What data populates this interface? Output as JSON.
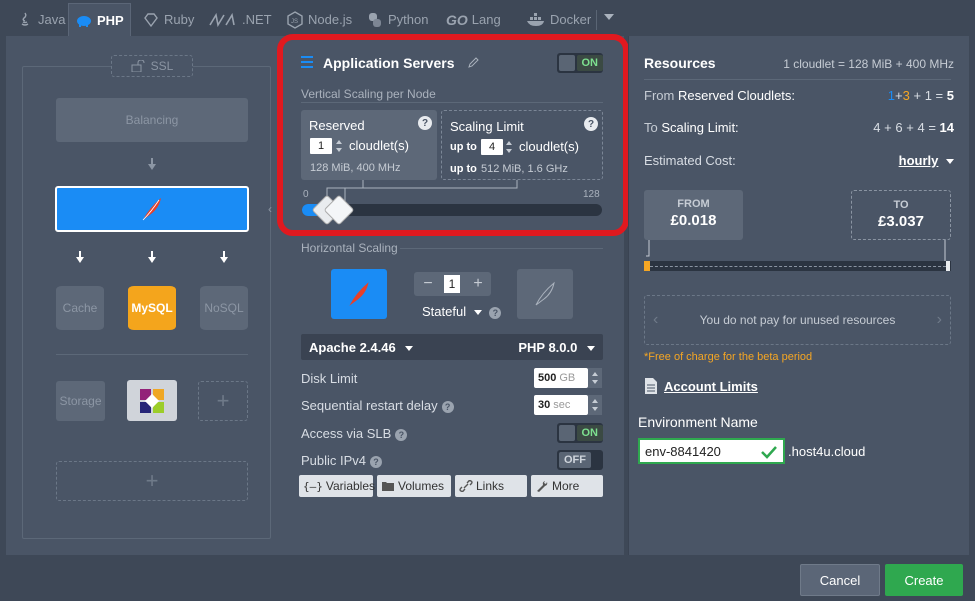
{
  "tabs": [
    {
      "label": "Java",
      "icon": "java-icon"
    },
    {
      "label": "PHP",
      "icon": "php-elephant-icon",
      "active": true
    },
    {
      "label": "Ruby",
      "icon": "ruby-icon"
    },
    {
      "label": ".NET",
      "icon": "dotnet-icon"
    },
    {
      "label": "Node.js",
      "icon": "nodejs-icon"
    },
    {
      "label": "Python",
      "icon": "python-icon"
    },
    {
      "label": "Lang",
      "icon": "go-icon",
      "prefix": "GO"
    },
    {
      "label": "Docker",
      "icon": "docker-icon"
    }
  ],
  "topology": {
    "ssl": "SSL",
    "balancing": "Balancing",
    "cache": "Cache",
    "nosql": "NoSQL",
    "mysql": "MySQL",
    "storage": "Storage"
  },
  "app_servers": {
    "title": "Application Servers",
    "toggle": "ON",
    "vertical_label": "Vertical Scaling per Node",
    "reserved": {
      "title": "Reserved",
      "value": "1",
      "unit": "cloudlet(s)",
      "sub": "128 MiB, 400 MHz"
    },
    "limit": {
      "title": "Scaling Limit",
      "prefix": "up to",
      "value": "4",
      "unit": "cloudlet(s)",
      "sub_prefix": "up to",
      "sub": "512 MiB, 1.6 GHz"
    },
    "slider_min": "0",
    "slider_max": "128",
    "horizontal_label": "Horizontal Scaling",
    "node_count": "1",
    "stateful": "Stateful",
    "server_version": "Apache 2.4.46",
    "php_version": "PHP 8.0.0",
    "disk_limit_label": "Disk Limit",
    "disk_limit_value": "500",
    "disk_limit_unit": "GB",
    "restart_label": "Sequential restart delay",
    "restart_value": "30",
    "restart_unit": "sec",
    "slb_label": "Access via SLB",
    "slb_toggle": "ON",
    "ipv4_label": "Public IPv4",
    "ipv4_toggle": "OFF",
    "buttons": {
      "variables": "Variables",
      "volumes": "Volumes",
      "links": "Links",
      "more": "More"
    }
  },
  "resources": {
    "title": "Resources",
    "cloudlet_def": "1 cloudlet = 128 MiB + 400 MHz",
    "reserved_label_pre": "From",
    "reserved_label": "Reserved Cloudlets:",
    "reserved_parts": [
      "1",
      "+",
      "3",
      "+",
      "1",
      "=",
      "5"
    ],
    "limit_label_pre": "To",
    "limit_label": "Scaling Limit:",
    "limit_parts": [
      "4",
      "+",
      "6",
      "+",
      "4",
      "=",
      "14"
    ],
    "cost_label": "Estimated Cost:",
    "cost_period": "hourly",
    "from_label": "FROM",
    "from_value": "£0.018",
    "to_label": "TO",
    "to_value": "£3.037",
    "unused_note": "You do not pay for unused resources",
    "beta_note": "*Free of charge for the beta period",
    "account_limits": "Account Limits"
  },
  "environment": {
    "label": "Environment Name",
    "value": "env-8841420",
    "domain": ".host4u.cloud"
  },
  "footer": {
    "cancel": "Cancel",
    "create": "Create"
  },
  "colors": {
    "accent": "#1a8cf5",
    "success": "#2fa84f",
    "highlight": "#e0191f",
    "warning": "#f5a623"
  }
}
